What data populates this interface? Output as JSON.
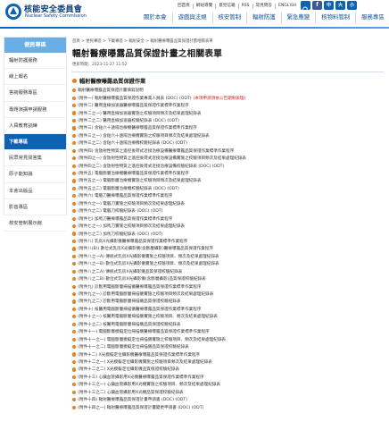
{
  "org": {
    "name": "核能安全委員會",
    "name_en": "Nuclear Safety Commission"
  },
  "util_links": [
    "回首頁",
    "網站導覽",
    "意見信箱",
    "RSS",
    "常見問答",
    "ENGLISH"
  ],
  "font_buttons": [
    "中",
    "大",
    "小"
  ],
  "main_nav": [
    "關於本會",
    "遊戲與法規",
    "核安管制",
    "輻射防護",
    "緊急應變",
    "核物料管制",
    "服務專區"
  ],
  "sidebar": {
    "title": "便民專區",
    "items": [
      "輻射防護服務",
      "線上報名",
      "答詢服務專區",
      "專題演講申請服務",
      "人員教育訓練",
      "下載專區",
      "民眾常見問答集",
      "原子能知識",
      "本會出版品",
      "影音專區",
      "核安管制展示館"
    ],
    "active_index": 5
  },
  "breadcrumb": "首頁 > 便民專區 > 下載專區 > 輻射安全 > 輻射醫療曝露品質保證計畫相關表單",
  "page_title": "輻射醫療曝露品質保證計畫之相關表單",
  "update": "更新時間：2023-11-27 11:52",
  "section_title": "輻射醫療曝露品質保證作業",
  "docs": [
    {
      "text": "輻射醫療曝露品質保證計畫填寫說明"
    },
    {
      "text": "(附件一) 輻射醫療曝露品質保證作業專責人員表 (DOC) (ODT)",
      "note": "(本項申請須依公告期限辦理)"
    },
    {
      "text": "(附件二) 醫用直線加速器醫療曝露品質保證作業標準作業程序"
    },
    {
      "text": "(附件二之一) 醫用直線加速器實施之校驗項目頻次及結果處理紀錄表"
    },
    {
      "text": "(附件二之二) 醫用直線加速器校驗紀錄表 (DOC) (ODT)"
    },
    {
      "text": "(附件三) 含鈷六十遠隔治療機醫療曝露品質保證作業標準作業程序"
    },
    {
      "text": "(附件三之一) 含鈷六十遠隔治療機實施之校驗項目頻次及結果處理紀錄表"
    },
    {
      "text": "(附件三之二) 含鈷六十遠隔治療機校驗紀錄表 (DOC) (ODT)"
    },
    {
      "text": "(附件四) 含放射性物質之遙控後荷式近接治療設備醫療曝露品質保證作業標準作業程序"
    },
    {
      "text": "(附件四之一) 含放射性物質之遙控後荷式近接治療設備實施之校驗項目頻次及結果處理紀錄表"
    },
    {
      "text": "(附件四之二) 含放射性物質之遙控後荷式近接治療設備校驗紀錄表 (DOC) (ODT)"
    },
    {
      "text": "(附件五) 電腦斷層治療機醫療曝露品質保證作業標準作業程序"
    },
    {
      "text": "(附件五之一) 電腦斷層治療機實施之校驗項目頻次及結果處理紀錄表"
    },
    {
      "text": "(附件五之二) 電腦斷層治療機校驗紀錄表 (DOC) (ODT)"
    },
    {
      "text": "(附件六) 電腦刀醫療曝露品質保證作業標準作業程序"
    },
    {
      "text": "(附件六之一) 電腦刀實施之校驗項目頻次及結果處理紀錄表"
    },
    {
      "text": "(附件六之二) 電腦刀校驗紀錄表 (DOC) (ODT)"
    },
    {
      "text": "(附件七) 加馬刀醫療曝露品質保證作業標準作業程序"
    },
    {
      "text": "(附件七之一) 加馬刀實施之校驗項目頻次及結果處理紀錄表"
    },
    {
      "text": "(附件七之二) 加馬刀校驗紀錄表 (DOC) (ODT)"
    },
    {
      "text": "(附件八) 乳房X光攝影儀醫療曝露品質保證作業標準作業程序"
    },
    {
      "text": "(附件八(B)) 數位式乳房X光攝影儀(含斷層攝影)醫療曝露品質保證作業程序"
    },
    {
      "text": "(附件八之一A) 傳統式乳房X光攝影儀實施之校驗項目、頻次及結果處理紀錄表"
    },
    {
      "text": "(附件八之一B) 數位式乳房X光攝影儀實施之校驗項目、頻次及結果處理紀錄表"
    },
    {
      "text": "(附件八之二A) 傳統式乳房X光攝影儀品質保證校驗紀錄表"
    },
    {
      "text": "(附件八之二B) 數位式乳房X光攝影儀(含斷層攝影)品質保證校驗紀錄表"
    },
    {
      "text": "(附件九) 診斷用電腦斷層掃描儀醫療曝露品質保證作業標準作業程序"
    },
    {
      "text": "(附件九之一) 診斷用電腦斷層掃描儀實施之校驗項目頻次及結果處理紀錄表"
    },
    {
      "text": "(附件九之二) 診斷用電腦斷層掃描儀品質保證校驗紀錄表"
    },
    {
      "text": "(附件十) 核醫用電腦斷層掃描儀醫療曝露品質保證作業標準作業程序"
    },
    {
      "text": "(附件十之一) 核醫用電腦斷層掃描儀實施之校驗項目、頻次及結果處理紀錄表"
    },
    {
      "text": "(附件十之二) 核醫用電腦斷層掃描儀品質保證校驗紀錄表"
    },
    {
      "text": "(附件十一) 電腦斷層模擬定位掃描儀醫療曝露品質保證作業標準作業程序"
    },
    {
      "text": "(附件十一之一) 電腦斷層模擬定位掃描儀實施之校驗項目、頻次及結果處理紀錄表"
    },
    {
      "text": "(附件十一之二) 電腦斷層模擬定位掃描儀品質保證校驗紀錄表"
    },
    {
      "text": "(附件十二) X光模擬定位攝影機醫療曝露品質保證作業標準作業程序"
    },
    {
      "text": "(附件十二之一) X光模擬定位攝影機實施之校驗項目頻次及結果處理紀錄表"
    },
    {
      "text": "(附件十二之二) X光模擬定位攝影機品質保證校驗紀錄表"
    },
    {
      "text": "(附件十三) 心臟血管攝影用X光機醫療曝露品質保證作業標準作業程序"
    },
    {
      "text": "(附件十三之一) 心臟血管攝影用X光機實施之校驗項目、頻次及結果處理紀錄表"
    },
    {
      "text": "(附件十三之二) 心臟血管攝影用X光機品質保證校驗紀錄表"
    },
    {
      "text": "(附件十四) 輻射醫療曝露品質保證計畫申請書 (DOC) (ODT)"
    },
    {
      "text": "(附件十四之一) 輻射醫療曝露品質保證計畫變更申請書 (DOC) (ODT)"
    }
  ],
  "colors": {
    "brand": "#0e62b3",
    "bullet": "#e8811f",
    "note": "#d02020"
  }
}
